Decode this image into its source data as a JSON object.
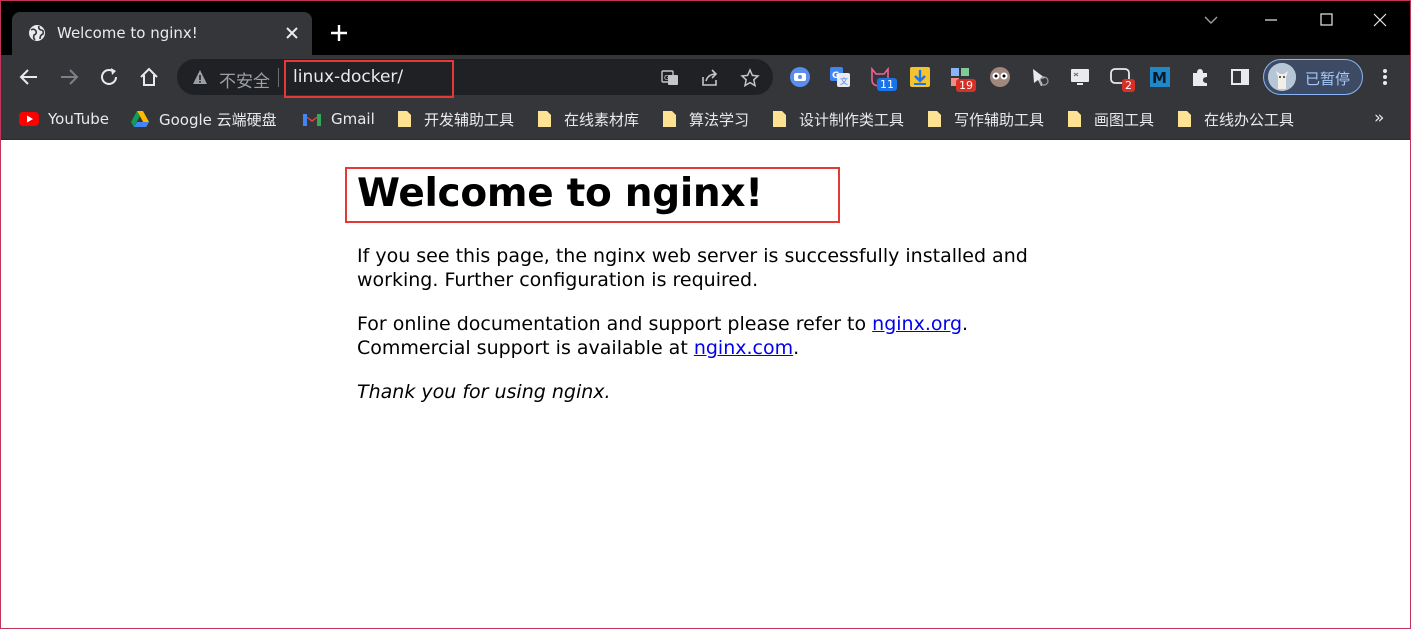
{
  "browser": {
    "tab": {
      "title": "Welcome to nginx!"
    },
    "omnibox": {
      "security_label": "不安全",
      "url": "linux-docker/"
    },
    "profile": {
      "label": "已暂停"
    },
    "extension_badges": {
      "ext_3": "11",
      "ext_5": "19",
      "ext_9": "2"
    },
    "bookmarks": [
      {
        "label": "YouTube",
        "icon": "youtube-icon"
      },
      {
        "label": "Google 云端硬盘",
        "icon": "google-drive-icon"
      },
      {
        "label": "Gmail",
        "icon": "gmail-icon"
      },
      {
        "label": "开发辅助工具",
        "icon": "folder-icon"
      },
      {
        "label": "在线素材库",
        "icon": "folder-icon"
      },
      {
        "label": "算法学习",
        "icon": "folder-icon"
      },
      {
        "label": "设计制作类工具",
        "icon": "folder-icon"
      },
      {
        "label": "写作辅助工具",
        "icon": "folder-icon"
      },
      {
        "label": "画图工具",
        "icon": "folder-icon"
      },
      {
        "label": "在线办公工具",
        "icon": "folder-icon"
      }
    ],
    "bookmarks_overflow": "»"
  },
  "page": {
    "heading": "Welcome to nginx!",
    "p1_line1": "If you see this page, the nginx web server is successfully installed and",
    "p1_line2": "working. Further configuration is required.",
    "p2_line1_prefix": "For online documentation and support please refer to ",
    "p2_link1": "nginx.org",
    "p2_line1_suffix": ".",
    "p2_line2_prefix": "Commercial support is available at ",
    "p2_link2": "nginx.com",
    "p2_line2_suffix": ".",
    "p3": "Thank you for using nginx."
  },
  "colors": {
    "accent_highlight": "#e53935",
    "link": "#0000ee",
    "chrome_dark": "#35363a"
  }
}
